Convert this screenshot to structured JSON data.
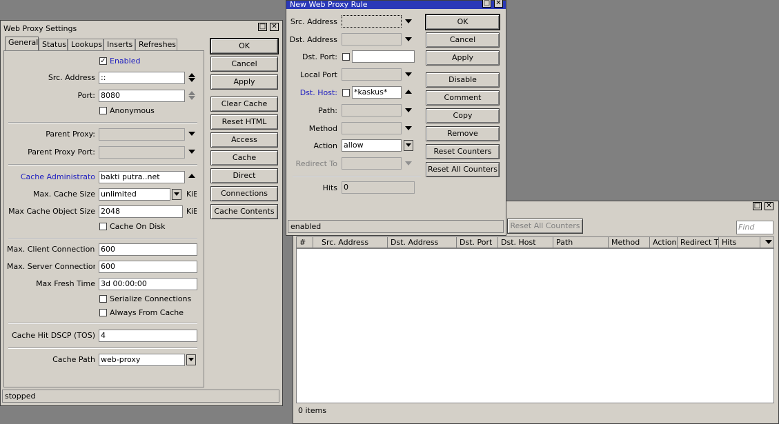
{
  "ruleList": {
    "reset_all_counters": "Reset All Counters",
    "find_placeholder": "Find",
    "columns": [
      "#",
      "Src. Address",
      "Dst. Address",
      "Dst. Port",
      "Dst. Host",
      "Path",
      "Method",
      "Action",
      "Redirect T",
      "Hits"
    ],
    "status": "0 items"
  },
  "settings": {
    "title": "Web Proxy Settings",
    "tabs": [
      "General",
      "Status",
      "Lookups",
      "Inserts",
      "Refreshes"
    ],
    "enabled_label": "Enabled",
    "src_address_label": "Src. Address",
    "src_address_value": "::",
    "port_label": "Port:",
    "port_value": "8080",
    "anonymous_label": "Anonymous",
    "parent_proxy_label": "Parent Proxy:",
    "parent_proxy_port_label": "Parent Proxy Port:",
    "cache_admin_label": "Cache Administrato",
    "cache_admin_value": "bakti putra..net",
    "max_cache_size_label": "Max. Cache Size",
    "max_cache_size_value": "unlimited",
    "unit_kib": "KiB",
    "max_cache_object_label": "Max Cache Object Size",
    "max_cache_object_value": "2048",
    "cache_on_disk_label": "Cache On Disk",
    "max_client_label": "Max. Client Connections",
    "max_client_value": "600",
    "max_server_label": "Max. Server Connections",
    "max_server_value": "600",
    "max_fresh_label": "Max Fresh Time",
    "max_fresh_value": "3d 00:00:00",
    "serialize_label": "Serialize Connections",
    "always_cache_label": "Always From Cache",
    "dscp_label": "Cache Hit DSCP (TOS)",
    "dscp_value": "4",
    "cache_path_label": "Cache Path",
    "cache_path_value": "web-proxy",
    "buttons": [
      "OK",
      "Cancel",
      "Apply",
      "Clear Cache",
      "Reset HTML",
      "Access",
      "Cache",
      "Direct",
      "Connections",
      "Cache Contents"
    ],
    "status": "stopped"
  },
  "rule": {
    "title": "New Web Proxy Rule",
    "src_address_label": "Src. Address",
    "dst_address_label": "Dst. Address",
    "dst_port_label": "Dst. Port:",
    "local_port_label": "Local Port",
    "dst_host_label": "Dst. Host:",
    "dst_host_value": "*kaskus*",
    "path_label": "Path:",
    "method_label": "Method",
    "action_label": "Action",
    "action_value": "allow",
    "redirect_label": "Redirect To",
    "hits_label": "Hits",
    "hits_value": "0",
    "buttons": [
      "OK",
      "Cancel",
      "Apply",
      "Disable",
      "Comment",
      "Copy",
      "Remove",
      "Reset Counters",
      "Reset All Counters"
    ],
    "status": "enabled"
  }
}
